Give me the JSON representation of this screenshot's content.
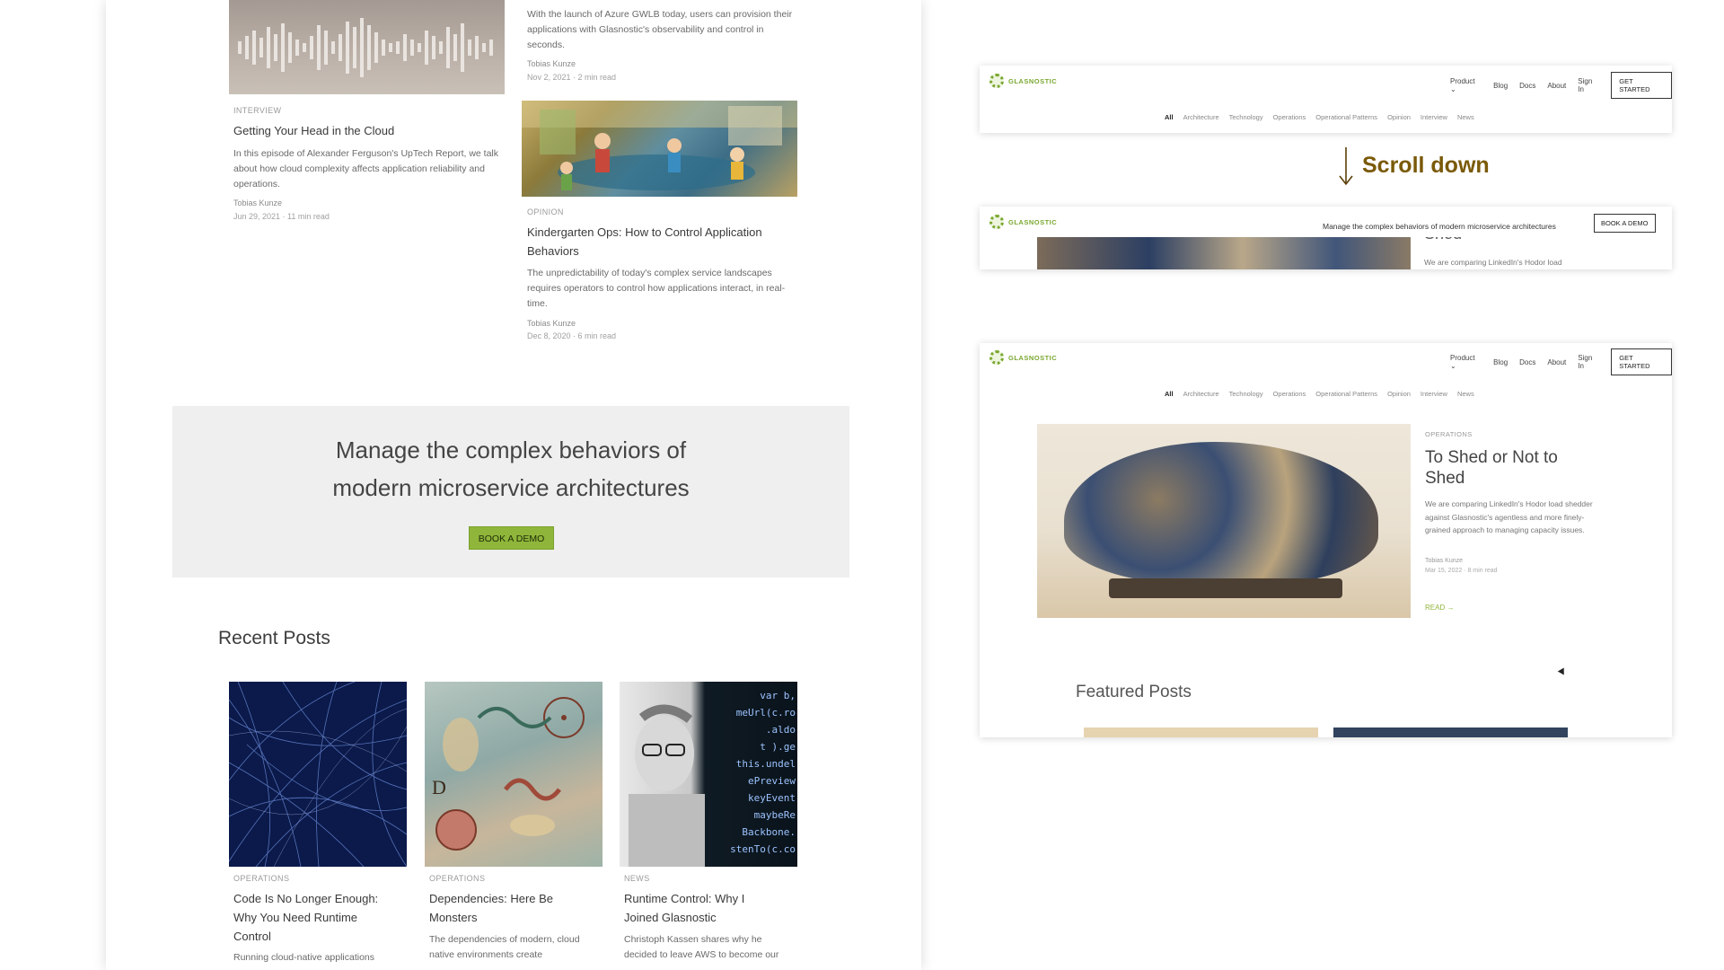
{
  "left": {
    "top_post_desc": "With the launch of Azure GWLB today, users can provision their applications with Glasnostic's observability and control in seconds.",
    "top_post_author": "Tobias Kunze",
    "top_post_meta": "Nov 2, 2021 · 2 min read",
    "post_interview": {
      "category": "INTERVIEW",
      "title": "Getting Your Head in the Cloud",
      "desc": "In this episode of Alexander Ferguson's UpTech Report, we talk about how cloud complexity affects application reliability and operations.",
      "author": "Tobias Kunze",
      "meta": "Jun 29, 2021 · 11 min read"
    },
    "post_opinion": {
      "category": "OPINION",
      "title": "Kindergarten Ops: How to Control Application Behaviors",
      "desc": "The unpredictability of today's complex service landscapes requires operators to control how applications interact, in real-time.",
      "author": "Tobias Kunze",
      "meta": "Dec 8, 2020 · 6 min read"
    },
    "cta": {
      "line1": "Manage the complex behaviors of",
      "line2": "modern microservice architectures",
      "button": "BOOK A DEMO"
    },
    "recent_title": "Recent Posts",
    "recent": [
      {
        "category": "OPERATIONS",
        "title_l1": "Code Is No Longer Enough:",
        "title_l2": "Why You Need Runtime",
        "title_l3": "Control",
        "desc": "Running cloud-native applications"
      },
      {
        "category": "OPERATIONS",
        "title_l1": "Dependencies: Here Be",
        "title_l2": "Monsters",
        "desc_l1": "The dependencies of modern, cloud",
        "desc_l2": "native environments create"
      },
      {
        "category": "NEWS",
        "title_l1": "Runtime Control: Why I",
        "title_l2": "Joined Glasnostic",
        "desc_l1": "Christoph Kassen shares why he",
        "desc_l2": "decided to leave AWS to become our"
      }
    ],
    "code_lines": [
      "var b,",
      "meUrl(c.ro",
      ".aldo",
      "t ).ge",
      "this.undel",
      "ePreview",
      "keyEvent",
      "maybeRe",
      "Backbone.",
      "stenTo(c.co"
    ]
  },
  "mockups": {
    "brand": "GLASNOSTIC",
    "nav": [
      "Product ⌄",
      "Blog",
      "Docs",
      "About",
      "Sign In"
    ],
    "nav_button": "GET STARTED",
    "categories": [
      "All",
      "Architecture",
      "Technology",
      "Operations",
      "Operational Patterns",
      "Opinion",
      "Interview",
      "News"
    ],
    "sticky_tagline": "Manage the complex behaviors of modern microservice architectures",
    "sticky_button": "BOOK A DEMO",
    "sticky_shed": "Shed",
    "sticky_desc": "We are comparing LinkedIn's Hodor load",
    "featured_post": {
      "category": "OPERATIONS",
      "title": "To Shed or Not to Shed",
      "desc": "We are comparing LinkedIn's Hodor load shedder against Glasnostic's agentless and more finely-grained approach to managing capacity issues.",
      "author": "Tobias Kunze",
      "meta": "Mar 15, 2022 · 8 min read",
      "read": "READ →"
    },
    "featured_title": "Featured Posts"
  },
  "scroll_label": "Scroll down",
  "colors": {
    "accent_green": "#8fb63a",
    "scroll_text": "#7a5a08"
  }
}
